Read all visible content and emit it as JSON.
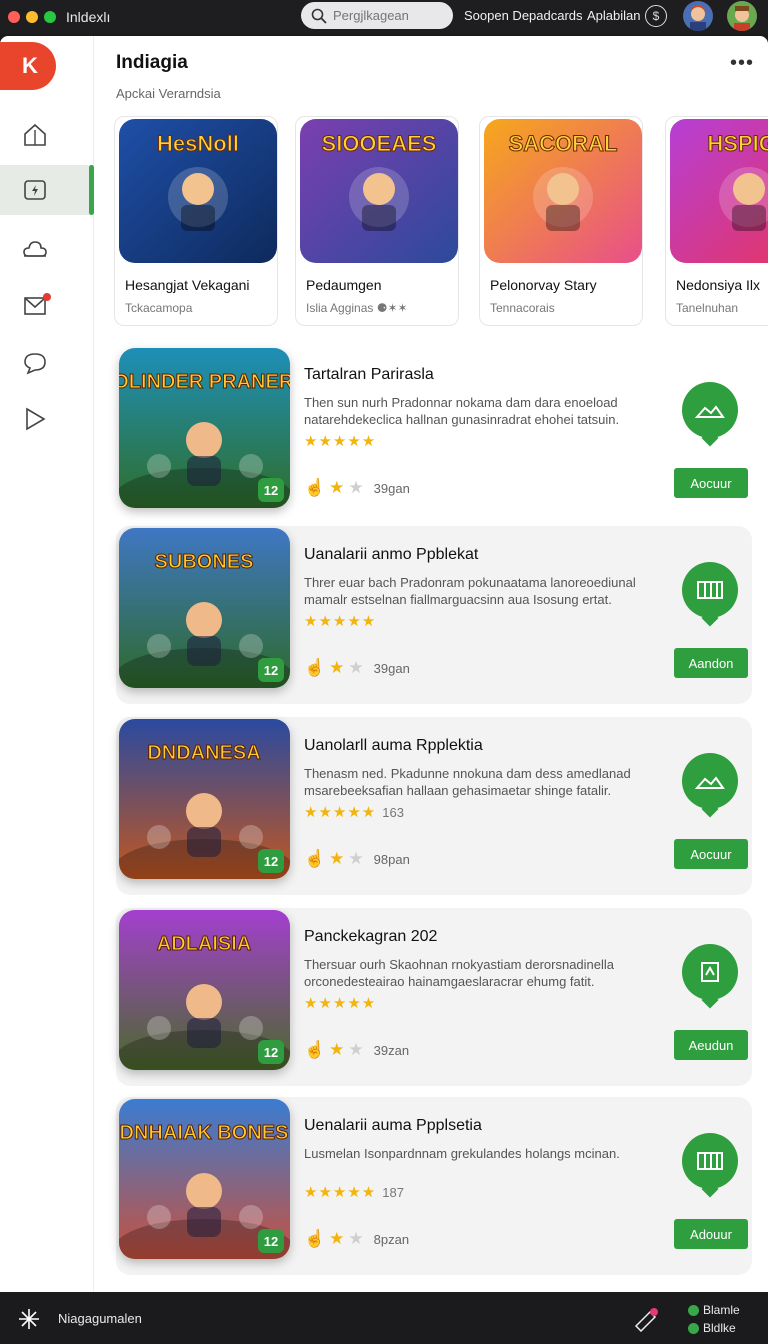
{
  "titlebar": {
    "app_title": "Inldexlı",
    "search_placeholder": "Pergjlkagean",
    "link1": "Soopen Depadcards",
    "link2": "Aplabilan",
    "link2_icon": "dollar-circle-icon",
    "dot_colors": [
      "#ff5f57",
      "#febc2e",
      "#28c840"
    ]
  },
  "sidebar": {
    "logo": "K",
    "items": [
      {
        "icon": "home-icon"
      },
      {
        "icon": "games-icon",
        "active": true
      },
      {
        "icon": "cloud-icon"
      },
      {
        "icon": "mail-icon",
        "badge": true
      },
      {
        "icon": "chat-icon"
      },
      {
        "icon": "play-icon"
      }
    ]
  },
  "header": {
    "title": "Indiagia",
    "subtitle": "Apckai Verarndsia",
    "more": "⋮"
  },
  "featured": [
    {
      "title": "Hesangjat Vekagani",
      "sub": "Tckacamopa",
      "art": "HesNoll",
      "colors": [
        "#1f4fa8",
        "#0e2a5c"
      ]
    },
    {
      "title": "Pedaumgen",
      "sub": "Islia Agginas ⚈✶✶",
      "art": "SIOOEAES",
      "colors": [
        "#7b3fb0",
        "#2c4a9a"
      ]
    },
    {
      "title": "Pelonorvay Stary",
      "sub": "Tennacorais",
      "art": "SACORAL",
      "colors": [
        "#f6a81b",
        "#e84f8a"
      ]
    },
    {
      "title": "Nedonsiya Ilx",
      "sub": "Tanelnuhan",
      "art": "HSPIGS",
      "colors": [
        "#b63fd6",
        "#e9345a"
      ]
    }
  ],
  "list": [
    {
      "title": "Tartalran Parirasla",
      "desc": "Then sun nurh Pradonnar nokama dam dara enoeload natarehdekeclica hallnan gunasinradrat ehohei tatsuin.",
      "stars": "★★★★★",
      "count": "",
      "meta": "39gan",
      "button": "Aocuur",
      "fab_icon": "landscape-icon",
      "art": "TOLINDER PRANERS",
      "colors": [
        "#1e8fb8",
        "#2f6e2a"
      ],
      "age": "1ᷲ"
    },
    {
      "title": "Uanalarii anmo Ppblekat",
      "desc": "Threr euar bach Pradonram pokunaatama lanoreoediunal mamalr estselnan fiallmarguacsinn aua Isosung ertat.",
      "stars": "★★★★★",
      "count": "",
      "meta": "39gan",
      "button": "Aandon",
      "fab_icon": "map-icon",
      "art": "SUBONES",
      "colors": [
        "#3f77c4",
        "#2e6a2a"
      ],
      "age": "1ᷲ"
    },
    {
      "title": "Uanolarll auma Rpplektia",
      "desc": "Thenasm ned. Pkadunne nnokuna dam dess amedlanad msarebeeksafian hallaan gehasimaetar shinge fatalir.",
      "stars": "★★★★★",
      "count": "163",
      "meta": "98pan",
      "button": "Aocuur",
      "fab_icon": "landscape-icon",
      "art": "DNDANESA",
      "colors": [
        "#2a4aa0",
        "#c2571f"
      ],
      "age": "1ᷲ"
    },
    {
      "title": "Panckekagran 202",
      "desc": "Thersuar ourh Skaohnan rnokyastiam derorsnadinella orconedesteairao hainamgaeslaracrar ehumg fatit.",
      "stars": "★★★★★",
      "count": "",
      "meta": "39zan",
      "button": "Aeudun",
      "fab_icon": "book-icon",
      "art": "ADLAISIA",
      "colors": [
        "#a33fcf",
        "#4a6a2a"
      ],
      "age": "1ᷲ"
    },
    {
      "title": "Uenalarii auma Ppplsetia",
      "desc": "Lusmelan Isonpardnnam grekulandes holangs mcinan.",
      "stars": "★★★★★",
      "count": "187",
      "meta": "8pzan",
      "button": "Adouur",
      "fab_icon": "map-icon",
      "art": "DNHAIAK BONES",
      "colors": [
        "#3a7cd1",
        "#c8513d"
      ],
      "age": "1ᷲ"
    }
  ],
  "bottombar": {
    "label": "Niagagumalen",
    "stat1": "Blamle",
    "stat2": "Bldlke"
  }
}
